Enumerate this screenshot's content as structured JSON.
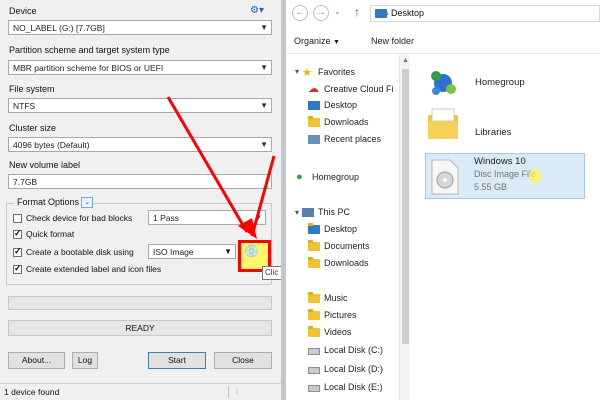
{
  "rufus": {
    "device_label": "Device",
    "device_value": "NO_LABEL (G:) [7.7GB]",
    "partition_label": "Partition scheme and target system type",
    "partition_value": "MBR partition scheme for BIOS or UEFI",
    "fs_label": "File system",
    "fs_value": "NTFS",
    "cluster_label": "Cluster size",
    "cluster_value": "4096 bytes (Default)",
    "volume_label": "New volume label",
    "volume_value": "7.7GB",
    "format_options_title": "Format Options",
    "check_bad_blocks": "Check device for bad blocks",
    "bad_blocks_passes": "1 Pass",
    "quick_format": "Quick format",
    "bootable_disk": "Create a bootable disk using",
    "bootable_source": "ISO Image",
    "extended_label": "Create extended label and icon files",
    "tooltip_text": "Clic",
    "status": "READY",
    "about_button": "About...",
    "log_button": "Log",
    "start_button": "Start",
    "close_button": "Close",
    "statusbar_text": "1 device found"
  },
  "rufus_state": {
    "check_bad_blocks": false,
    "quick_format": true,
    "bootable_disk": true,
    "extended_label": true,
    "progress": 0
  },
  "explorer": {
    "address": "Desktop",
    "toolbar": {
      "organize": "Organize",
      "new_folder": "New folder"
    },
    "nav": {
      "favorites": "Favorites",
      "favorites_items": [
        "Creative Cloud Fi",
        "Desktop",
        "Downloads",
        "Recent places"
      ],
      "homegroup": "Homegroup",
      "this_pc": "This PC",
      "this_pc_items": [
        "Desktop",
        "Documents",
        "Downloads",
        "Music",
        "Pictures",
        "Videos",
        "Local Disk (C:)",
        "Local Disk (D:)",
        "Local Disk (E:)"
      ]
    },
    "content": [
      {
        "name": "Homegroup"
      },
      {
        "name": "Libraries"
      },
      {
        "name": "Windows 10",
        "type": "Disc Image File",
        "size": "5.55 GB"
      }
    ]
  },
  "colors": {
    "annotation": "#ff0000",
    "highlight": "#fff76a",
    "accent": "#2f78c4"
  }
}
